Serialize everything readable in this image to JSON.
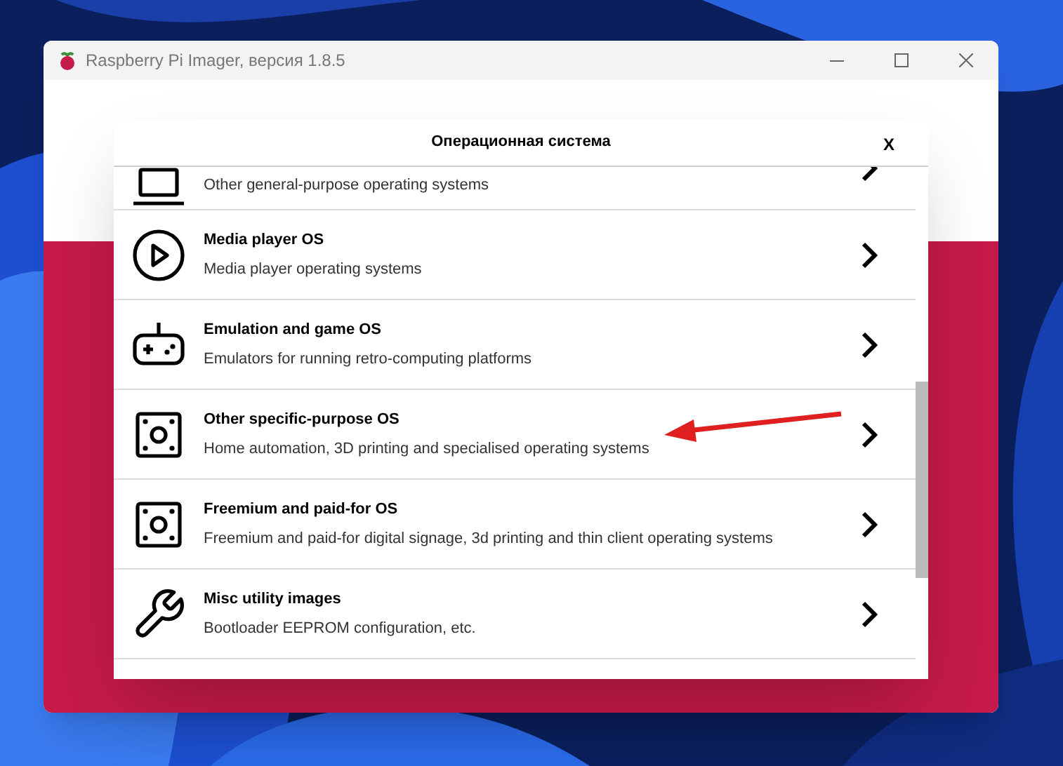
{
  "window": {
    "title": "Raspberry Pi Imager, версия 1.8.5"
  },
  "dialog": {
    "title": "Операционная система",
    "close": "X",
    "items": [
      {
        "kind": "partial",
        "description": "Other general-purpose operating systems"
      },
      {
        "kind": "full",
        "title": "Media player OS",
        "description": "Media player operating systems"
      },
      {
        "kind": "full",
        "title": "Emulation and game OS",
        "description": "Emulators for running retro-computing platforms"
      },
      {
        "kind": "full",
        "title": "Other specific-purpose OS",
        "description": "Home automation, 3D printing and specialised operating systems"
      },
      {
        "kind": "full",
        "title": "Freemium and paid-for OS",
        "description": "Freemium and paid-for digital signage, 3d printing and thin client operating systems"
      },
      {
        "kind": "full",
        "title": "Misc utility images",
        "description": "Bootloader EEPROM configuration, etc."
      }
    ]
  }
}
